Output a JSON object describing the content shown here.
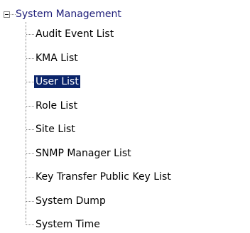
{
  "tree": {
    "root": {
      "label": "System Management",
      "expanded": true,
      "icon": "minus-box-icon"
    },
    "children": [
      {
        "label": "Audit Event List",
        "selected": false
      },
      {
        "label": "KMA List",
        "selected": false
      },
      {
        "label": "User List",
        "selected": true
      },
      {
        "label": "Role List",
        "selected": false
      },
      {
        "label": "Site List",
        "selected": false
      },
      {
        "label": "SNMP Manager List",
        "selected": false
      },
      {
        "label": "Key Transfer Public Key List",
        "selected": false
      },
      {
        "label": "System Dump",
        "selected": false
      },
      {
        "label": "System Time",
        "selected": false
      }
    ]
  },
  "colors": {
    "root_text": "#1f1f7a",
    "selection_bg": "#0a246a",
    "selection_text": "#ffffff",
    "tree_lines": "#808080"
  }
}
